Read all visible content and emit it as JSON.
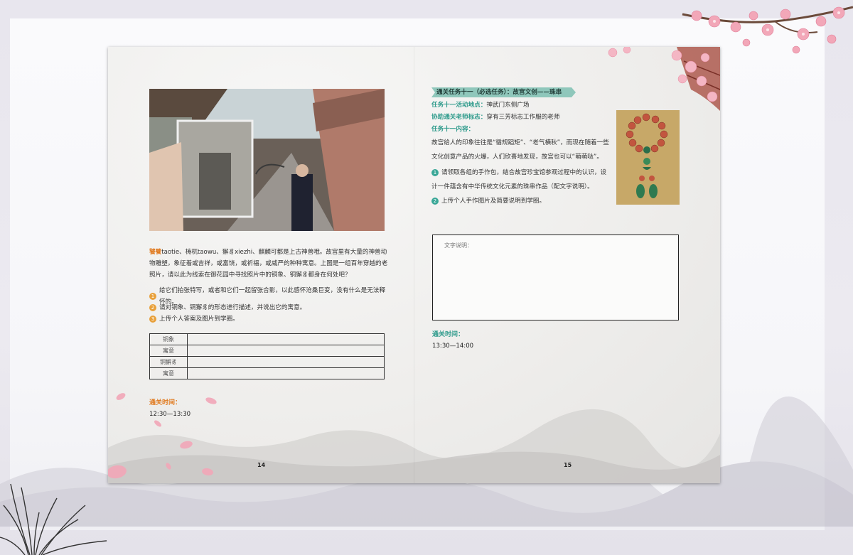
{
  "left_page": {
    "intro_highlight": "饕餮",
    "intro_text": "taotie、梼杌taowu、獬豸xiezhi、麒麟可都是上古神兽哦。故宫里有大量的神兽动物雕塑，象征着或吉祥，或富饶，或祈福，或威严的种种寓意。上图是一组百年穿越的老照片，请以此为线索在御花园中寻找照片中的铜象、铜獬豸都身在何处吧？",
    "tasks": [
      {
        "num": "1",
        "text": "给它们拍张特写，或者和它们一起留张合影，以此感怀沧桑巨变，没有什么是无法释怀的。"
      },
      {
        "num": "2",
        "text": "请对铜象、铜獬豸的形态进行描述，并说出它的寓意。"
      },
      {
        "num": "3",
        "text": "上传个人答案及图片到学圈。"
      }
    ],
    "table_rows": [
      "铜象",
      "寓意",
      "铜獬豸",
      "寓意"
    ],
    "time_title": "通关时间：",
    "time_value": "12:30—13:30",
    "page_number": "14"
  },
  "right_page": {
    "banner_title": "通关任务十一（必选任务）：故宫文创——珠串",
    "location_label": "任务十一活动地点：",
    "location_value": "神武门东侧广场",
    "teacher_label": "协助通关老师标志：",
    "teacher_value": "穿有三芳标志工作服的老师",
    "content_label": "任务十一内容：",
    "content_text": "故宫给人的印象往往是“循规蹈矩”、“老气横秋”，而现在随着一些文化创意产品的火爆，人们欣喜地发现，故宫也可以“萌萌哒”。",
    "tasks": [
      {
        "num": "1",
        "text": "请领取各组的手作包，结合故宫珍宝馆参观过程中的认识，设计一件蕴含有中华传统文化元素的珠串作品（配文字说明）。"
      },
      {
        "num": "2",
        "text": "上传个人手作图片及简要说明到学圈。"
      }
    ],
    "textbox_label": "文字说明：",
    "time_title": "通关时间：",
    "time_value": "13:30—14:00",
    "page_number": "15"
  },
  "colors": {
    "orange_accent": "#e07a1f",
    "teal_accent": "#2f9b8c",
    "banner": "#8fc7bb",
    "blossom": "#f2a7b8"
  },
  "icons": [
    "cherry-blossom",
    "ink-grass",
    "ink-mountains",
    "petal"
  ]
}
